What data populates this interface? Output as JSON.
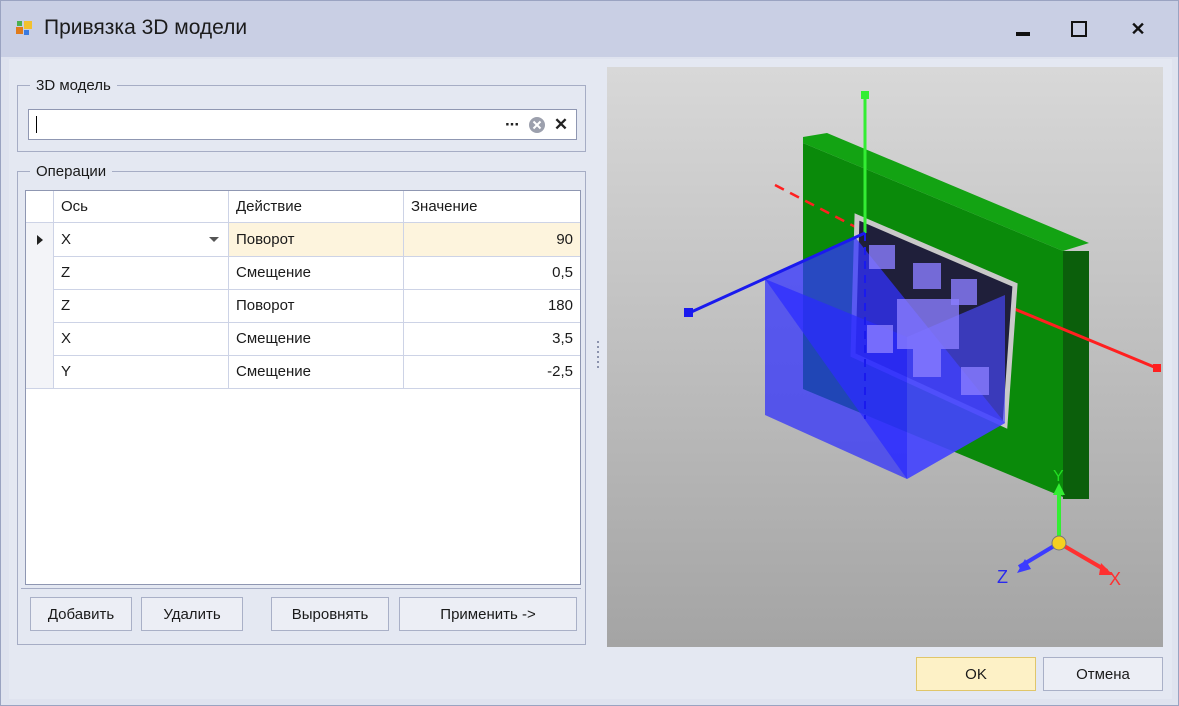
{
  "window": {
    "title": "Привязка 3D модели",
    "controls": {
      "minimize": "▬",
      "maximize": "☐",
      "close": "✕"
    }
  },
  "model_group": {
    "title": "3D модель",
    "field_value": "",
    "browse_label": "···",
    "clear_label": "⊗",
    "remove_label": "✕"
  },
  "operations": {
    "title": "Операции",
    "columns": [
      "Ось",
      "Действие",
      "Значение"
    ],
    "rows": [
      {
        "axis": "X",
        "action": "Поворот",
        "value": "90",
        "active": true
      },
      {
        "axis": "Z",
        "action": "Смещение",
        "value": "0,5"
      },
      {
        "axis": "Z",
        "action": "Поворот",
        "value": "180"
      },
      {
        "axis": "X",
        "action": "Смещение",
        "value": "3,5"
      },
      {
        "axis": "Y",
        "action": "Смещение",
        "value": "-2,5"
      }
    ],
    "buttons": {
      "add": "Добавить",
      "delete": "Удалить",
      "align": "Выровнять",
      "apply": "Применить ->"
    }
  },
  "viewport": {
    "axes_labels": {
      "x": "X",
      "y": "Y",
      "z": "Z"
    },
    "colors": {
      "board": "#0a8a0a",
      "component": "#3333ff",
      "x_axis": "#ff2020",
      "y_axis": "#33ee33",
      "z_axis": "#1a1aee"
    }
  },
  "footer": {
    "ok": "OK",
    "cancel": "Отмена"
  },
  "colors": {
    "accent_ok": "#fdf1c6",
    "title_bar": "#c9cfe4"
  }
}
